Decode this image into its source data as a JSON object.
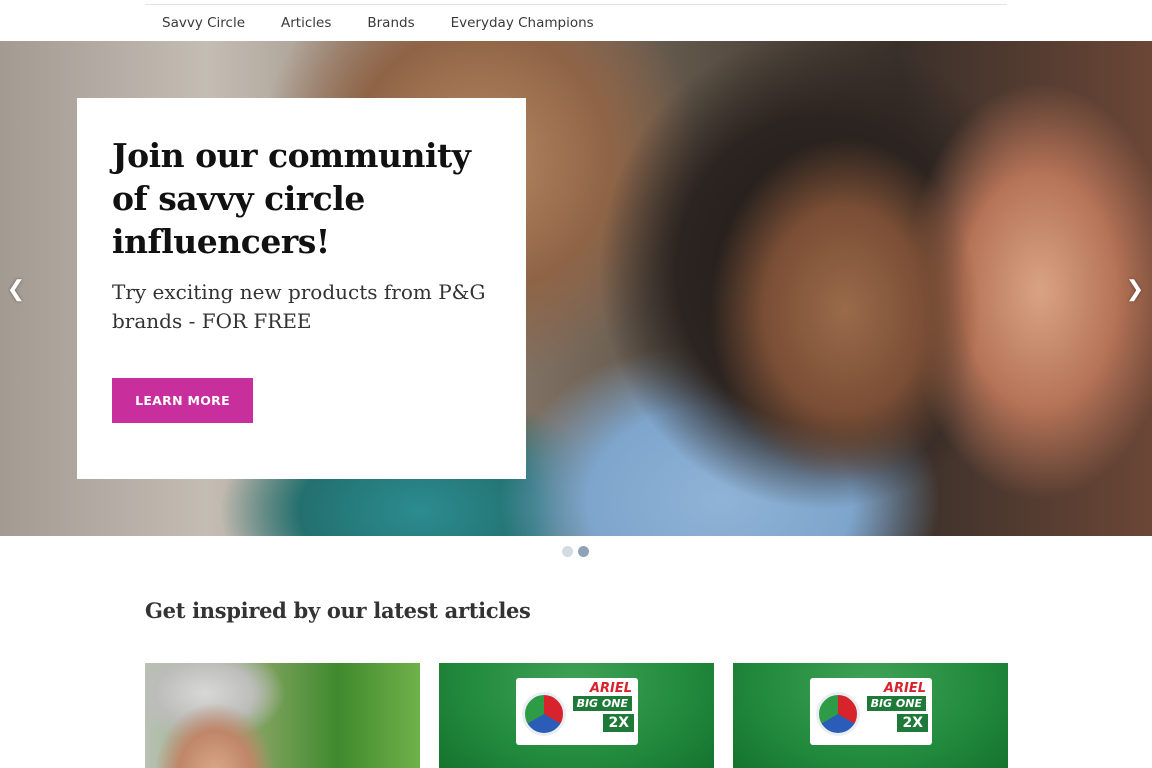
{
  "nav": {
    "items": [
      {
        "label": "Savvy Circle"
      },
      {
        "label": "Articles"
      },
      {
        "label": "Brands"
      },
      {
        "label": "Everyday Champions"
      }
    ]
  },
  "hero": {
    "headline": "Join our community of savvy circle influencers!",
    "subheadline": "Try exciting new products from P&G brands - FOR FREE",
    "cta_label": "LEARN MORE",
    "prev_icon": "chevron-left-icon",
    "next_icon": "chevron-right-icon",
    "slide_count": 2,
    "active_slide": 2
  },
  "articles": {
    "heading": "Get inspired by our latest articles",
    "cards": [
      {
        "image": "man-in-garden-photo"
      },
      {
        "image": "ariel-big-one-pack-photo",
        "brand": "ARIEL",
        "product": "BIG ONE",
        "badge": "2X"
      },
      {
        "image": "ariel-big-one-pack-photo",
        "brand": "ARIEL",
        "product": "BIG ONE",
        "badge": "2X"
      }
    ]
  },
  "colors": {
    "accent": "#c92e9d",
    "dot_active": "#8ea3b6",
    "dot_inactive": "#d3dbe3",
    "text_dark": "#111111"
  }
}
